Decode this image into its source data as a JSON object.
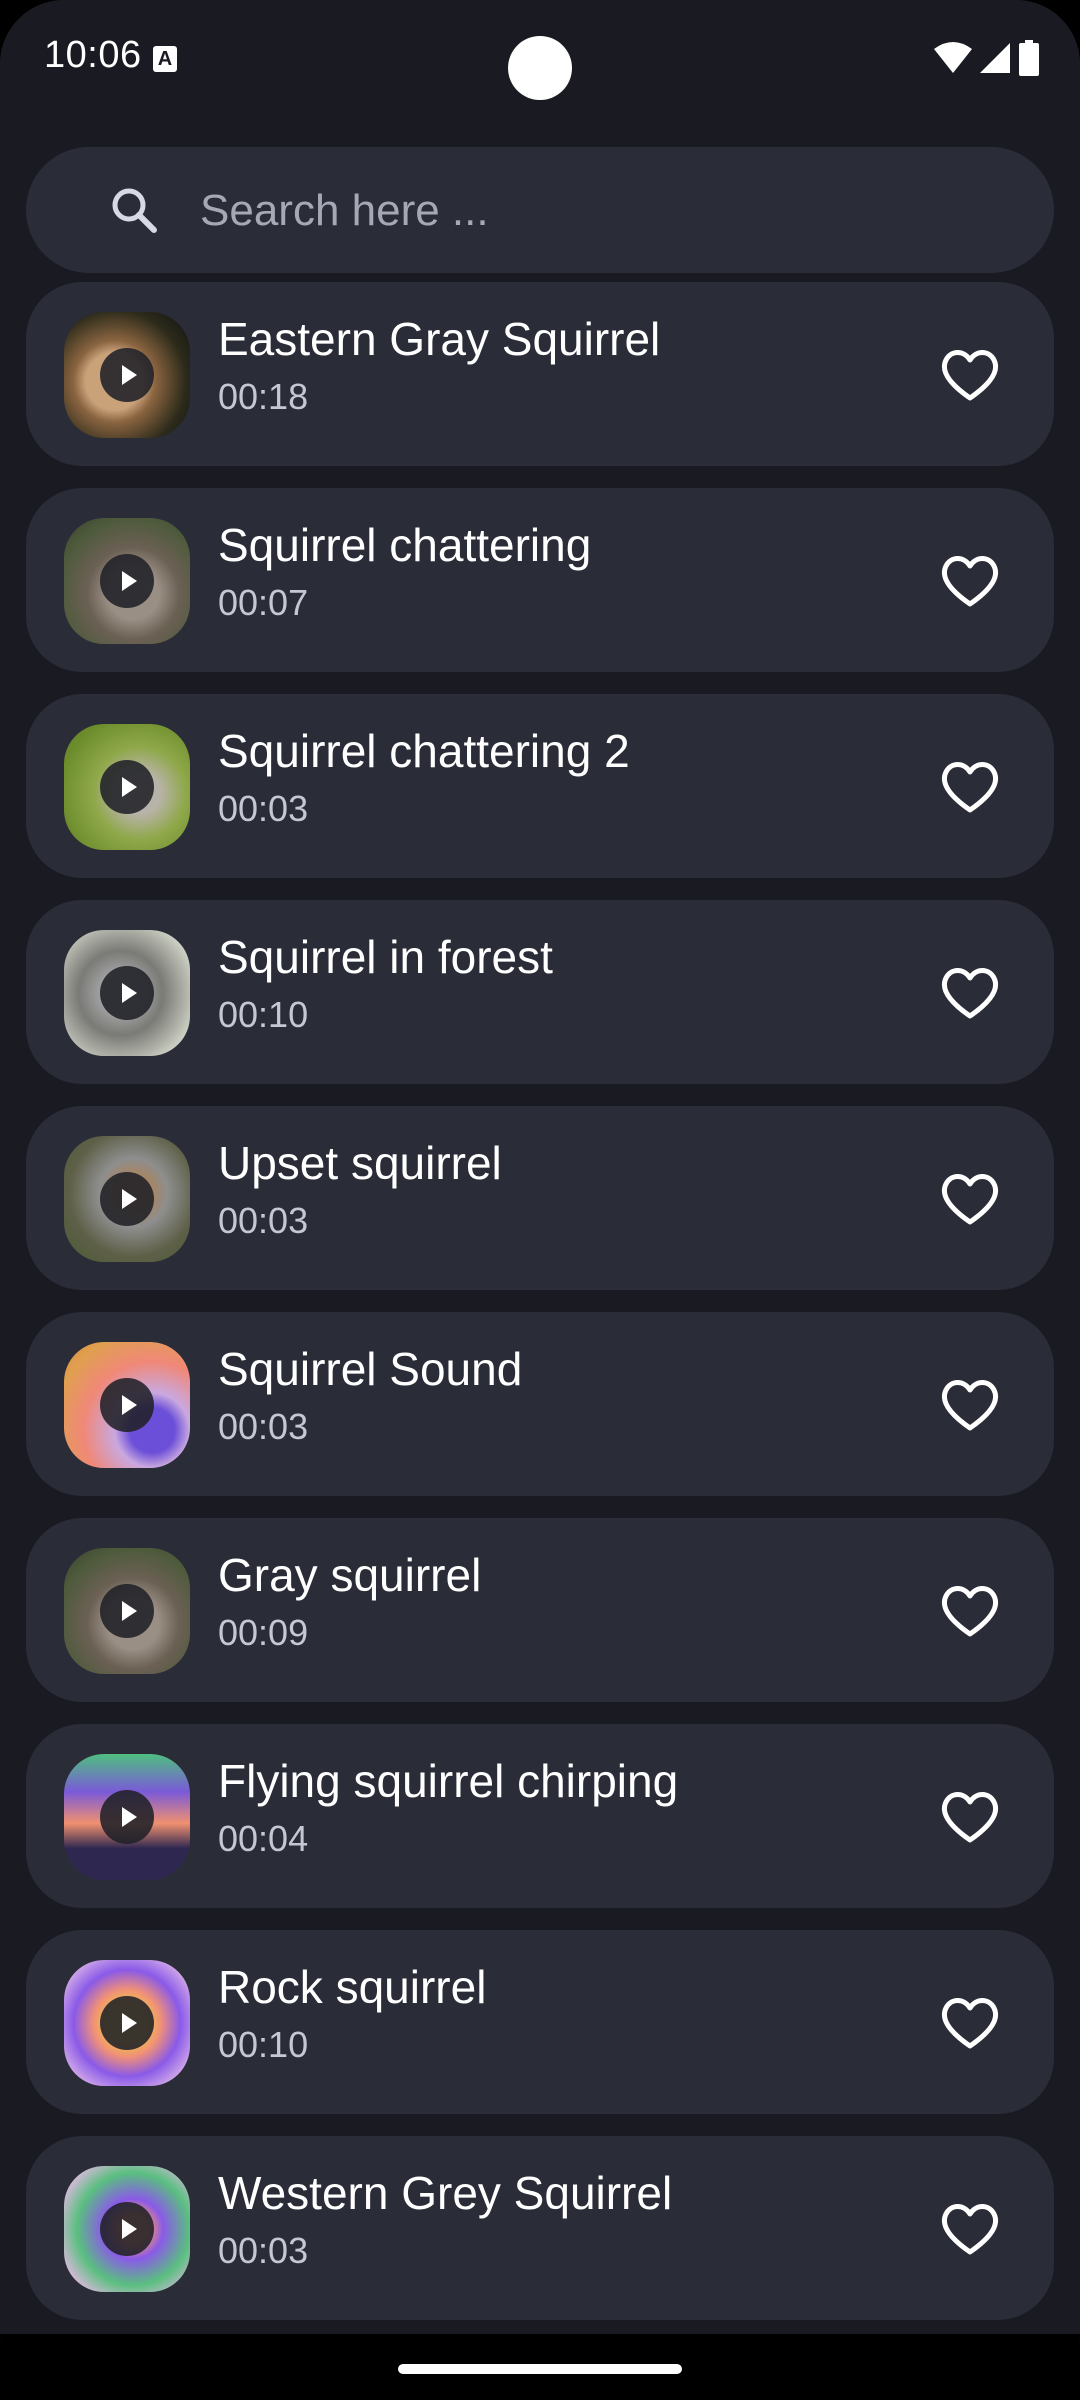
{
  "status_bar": {
    "time": "10:06",
    "notification_icon": "a-icon",
    "wifi_icon": "wifi-icon",
    "signal_icon": "signal-icon",
    "battery_icon": "battery-icon"
  },
  "search": {
    "placeholder": "Search here ...",
    "value": "",
    "icon": "search-icon"
  },
  "sounds": [
    {
      "title": "Eastern Gray Squirrel",
      "duration": "00:18",
      "thumbnail": "photo"
    },
    {
      "title": "Squirrel chattering",
      "duration": "00:07",
      "thumbnail": "photo"
    },
    {
      "title": "Squirrel chattering 2",
      "duration": "00:03",
      "thumbnail": "photo"
    },
    {
      "title": "Squirrel in forest",
      "duration": "00:10",
      "thumbnail": "photo"
    },
    {
      "title": "Upset squirrel",
      "duration": "00:03",
      "thumbnail": "photo"
    },
    {
      "title": "Squirrel Sound",
      "duration": "00:03",
      "thumbnail": "abstract-art"
    },
    {
      "title": "Gray squirrel",
      "duration": "00:09",
      "thumbnail": "photo"
    },
    {
      "title": "Flying squirrel chirping",
      "duration": "00:04",
      "thumbnail": "abstract-art"
    },
    {
      "title": "Rock squirrel",
      "duration": "00:10",
      "thumbnail": "abstract-art"
    },
    {
      "title": "Western Grey Squirrel",
      "duration": "00:03",
      "thumbnail": "abstract-art"
    }
  ],
  "colors": {
    "background": "#1a1b22",
    "card": "#2a2c38",
    "text_primary": "#ffffff",
    "text_secondary": "#c5c7d2"
  }
}
